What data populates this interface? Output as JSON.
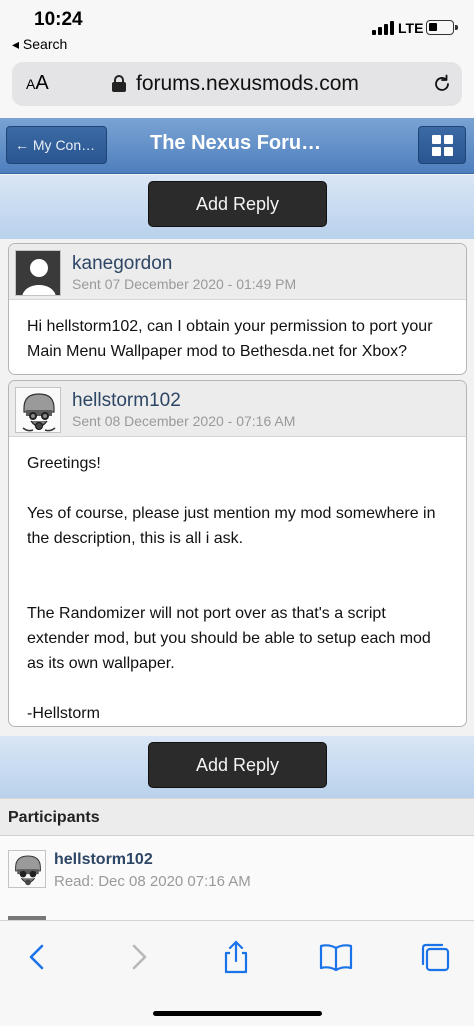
{
  "status_bar": {
    "time": "10:24",
    "back_app": "◂ Search",
    "network": "LTE"
  },
  "browser": {
    "text_size_label": "AA",
    "domain": "forums.nexusmods.com"
  },
  "header": {
    "back_label": "← My Con…",
    "title": "The Nexus Foru…"
  },
  "actions": {
    "add_reply_label": "Add Reply"
  },
  "messages": [
    {
      "author": "kanegordon",
      "sent": "Sent 07 December 2020 - 01:49 PM",
      "avatar": "default-user-avatar",
      "paragraphs": [
        "Hi hellstorm102, can I obtain your permission to port your Main Menu Wallpaper mod to Bethesda.net for Xbox?"
      ]
    },
    {
      "author": "hellstorm102",
      "sent": "Sent 08 December 2020 - 07:16 AM",
      "avatar": "helmet-gasmask-avatar",
      "paragraphs": [
        "Greetings!",
        "",
        "Yes of course, please just mention my mod somewhere in the description, this is all i ask.",
        "",
        "",
        "The Randomizer will not port over as that's a script extender mod, but you should be able to setup each mod as its own wallpaper.",
        "",
        "-Hellstorm"
      ]
    }
  ],
  "participants": {
    "title": "Participants",
    "items": [
      {
        "name": "hellstorm102",
        "read": "Read: Dec 08 2020 07:16 AM"
      }
    ]
  },
  "colors": {
    "header_blue": "#5b8ac6",
    "reply_button": "#2b2b2b",
    "author_link": "#2d4665",
    "reply_bar": "#c9dbf1",
    "safari_blue": "#1a73e8"
  }
}
